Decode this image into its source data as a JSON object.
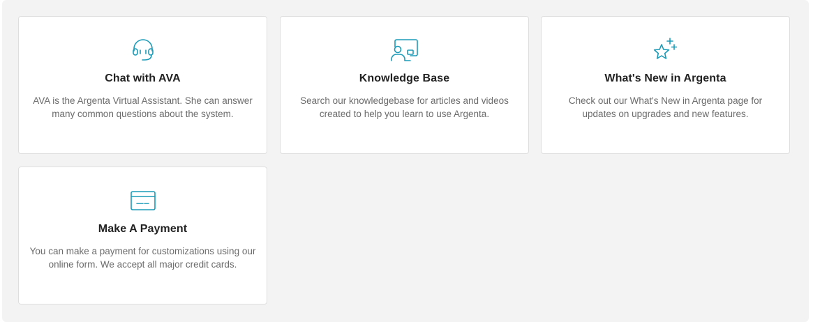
{
  "colors": {
    "accent": "#1a9bb8",
    "panel_bg": "#f3f3f3",
    "card_bg": "#ffffff",
    "title": "#222222",
    "text": "#6b6b6b"
  },
  "cards": [
    {
      "icon": "headset-icon",
      "title": "Chat with AVA",
      "description": "AVA is the Argenta Virtual Assistant. She can answer many common questions about the system."
    },
    {
      "icon": "presentation-screen-icon",
      "title": "Knowledge Base",
      "description": "Search our knowledgebase for articles and videos created to help you learn to use Argenta."
    },
    {
      "icon": "star-sparkle-icon",
      "title": "What's New in Argenta",
      "description": "Check out our What's New in Argenta page for updates on upgrades and new features."
    },
    {
      "icon": "credit-card-icon",
      "title": "Make A Payment",
      "description": "You can make a payment for customizations using our online form. We accept all major credit cards."
    }
  ]
}
